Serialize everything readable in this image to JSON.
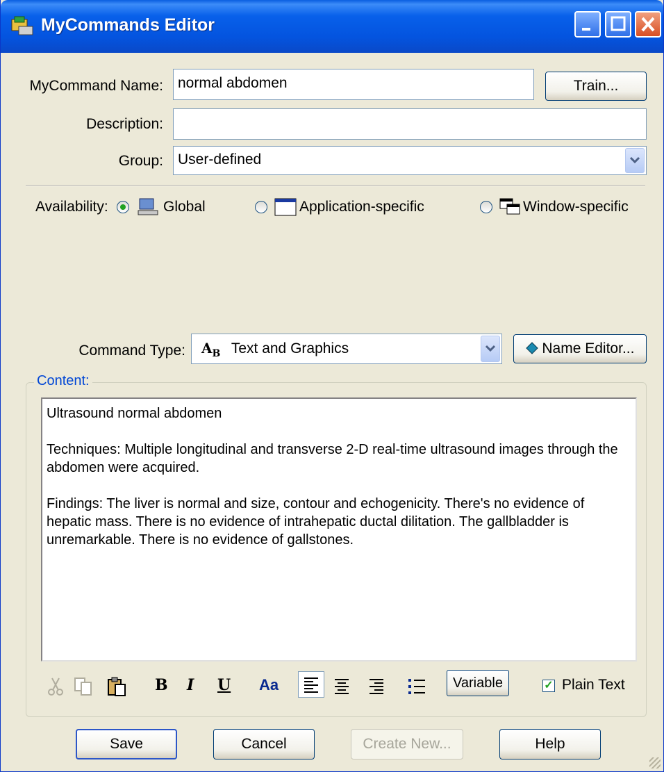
{
  "window": {
    "title": "MyCommands Editor"
  },
  "fields": {
    "name_label": "MyCommand Name:",
    "name_value": "normal abdomen",
    "train_button": "Train...",
    "description_label": "Description:",
    "description_value": "",
    "group_label": "Group:",
    "group_value": "User-defined"
  },
  "availability": {
    "label": "Availability:",
    "options": [
      {
        "label": "Global",
        "selected": true
      },
      {
        "label": "Application-specific",
        "selected": false
      },
      {
        "label": "Window-specific",
        "selected": false
      }
    ]
  },
  "command_type": {
    "label": "Command Type:",
    "value": "Text and Graphics",
    "name_editor_button": "Name Editor..."
  },
  "content": {
    "caption": "Content:",
    "paragraphs": [
      "Ultrasound normal abdomen",
      "Techniques: Multiple longitudinal and transverse 2-D real-time ultrasound images through the abdomen were acquired.",
      "Findings: The liver is normal and size, contour and echogenicity. There's no evidence of hepatic mass. There is no evidence of intrahepatic ductal dilitation. The gallbladder is unremarkable. There is no evidence of gallstones."
    ]
  },
  "toolbar": {
    "bold": "B",
    "italic": "I",
    "underline": "U",
    "font": "Aa",
    "variable_button": "Variable",
    "plain_text_label": "Plain Text",
    "plain_text_checked": true
  },
  "buttons": {
    "save": "Save",
    "cancel": "Cancel",
    "create_new": "Create New...",
    "help": "Help"
  }
}
